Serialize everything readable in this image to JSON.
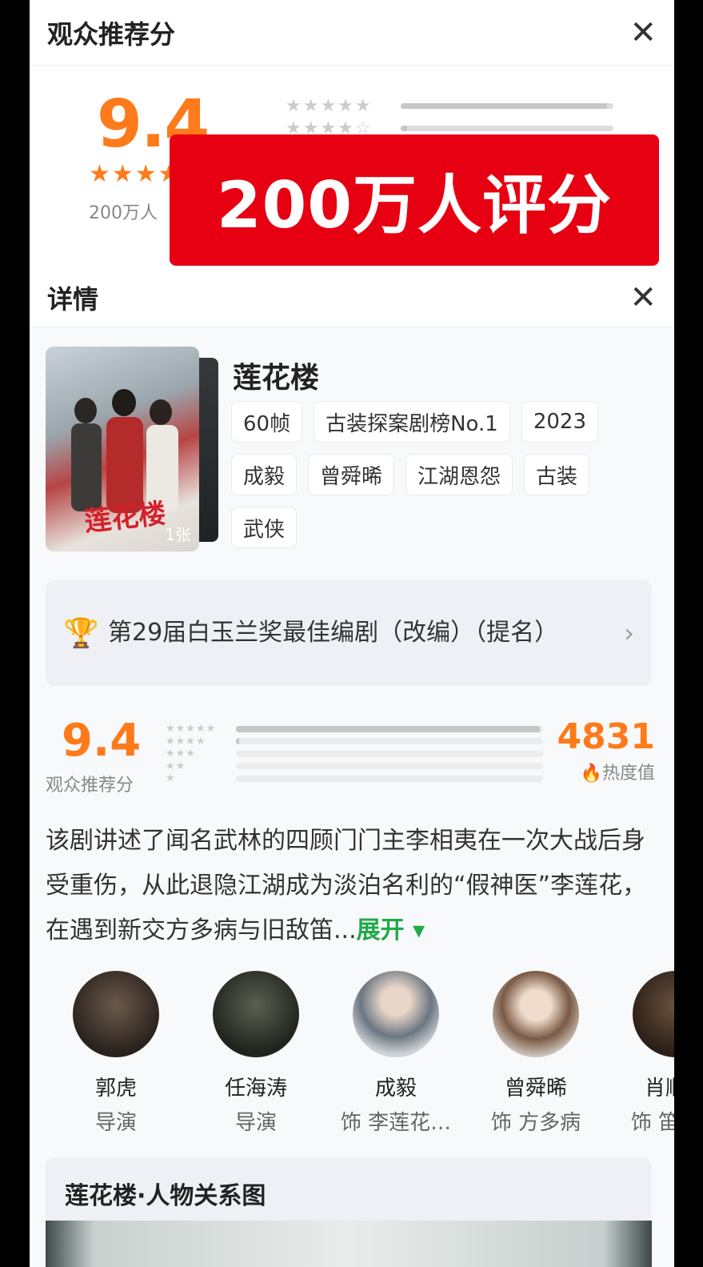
{
  "top_panel": {
    "title": "观众推荐分",
    "score": "9.4",
    "stars": "★★★★",
    "count_text": "200万人",
    "distribution": [
      0.97,
      0.03,
      0.0,
      0.0,
      0.0
    ]
  },
  "banner": {
    "text": "200万人评分"
  },
  "detail": {
    "title": "详情",
    "show_title": "莲花楼",
    "poster_logo": "莲花楼",
    "poster_count": "1张",
    "tags": [
      "60帧",
      "古装探案剧榜No.1",
      "2023",
      "成毅",
      "曾舜晞",
      "江湖恩怨",
      "古装",
      "武侠"
    ],
    "award": "第29届白玉兰奖最佳编剧（改编）（提名）",
    "rating": {
      "score": "9.4",
      "label": "观众推荐分",
      "distribution": [
        0.99,
        0.01,
        0.0,
        0.0,
        0.0
      ]
    },
    "heat": {
      "value": "4831",
      "label": "热度值"
    },
    "description": "该剧讲述了闻名武林的四顾门门主李相夷在一次大战后身受重伤，从此退隐江湖成为淡泊名利的“假神医”李莲花，在遇到新交方多病与旧敌笛...",
    "expand_label": "展开",
    "cast": [
      {
        "name": "郭虎",
        "role": "导演"
      },
      {
        "name": "任海涛",
        "role": "导演"
      },
      {
        "name": "成毅",
        "role": "饰 李莲花…"
      },
      {
        "name": "曾舜晞",
        "role": "饰 方多病"
      },
      {
        "name": "肖顺尧",
        "role": "饰 笛飞声"
      }
    ],
    "relation_title": "莲花楼·人物关系图"
  },
  "colors": {
    "accent": "#ff7a1a",
    "banner": "#e60012",
    "expand": "#22a94b"
  }
}
